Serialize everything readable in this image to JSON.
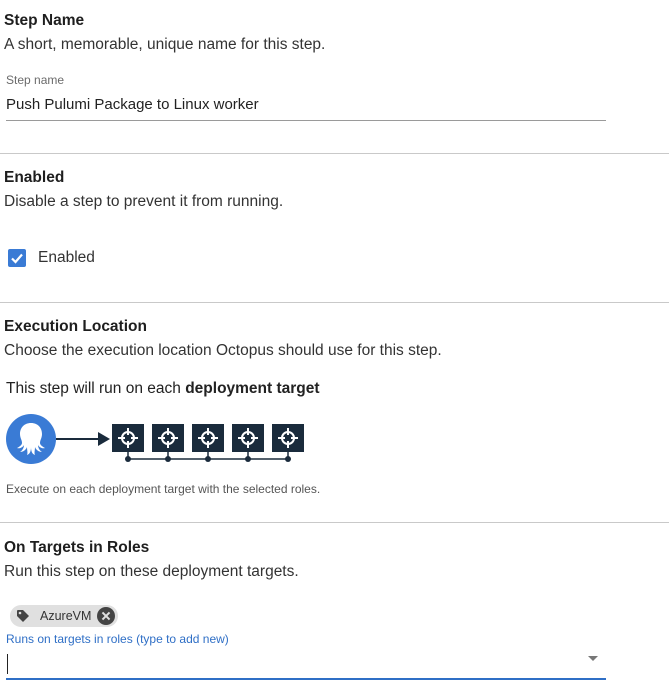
{
  "step_name_section": {
    "title": "Step Name",
    "description": "A short, memorable, unique name for this step.",
    "field_label": "Step name",
    "field_value": "Push Pulumi Package to Linux worker"
  },
  "enabled_section": {
    "title": "Enabled",
    "description": "Disable a step to prevent it from running.",
    "checkbox_label": "Enabled",
    "checked": true
  },
  "execution_section": {
    "title": "Execution Location",
    "description": "Choose the execution location Octopus should use for this step.",
    "run_text_prefix": "This step will run on each ",
    "run_text_bold": "deployment target",
    "hint": "Execute on each deployment target with the selected roles.",
    "diagram": {
      "source_icon": "octopus-icon",
      "target_icon": "deployment-target-icon",
      "target_count": 5,
      "colors": {
        "octopus_bg": "#3a7bd5",
        "target_bg": "#1a2b3c",
        "line": "#1a2b3c"
      }
    }
  },
  "roles_section": {
    "title": "On Targets in Roles",
    "description": "Run this step on these deployment targets.",
    "chips": [
      {
        "label": "AzureVM",
        "icon": "tag-icon"
      }
    ],
    "input_label": "Runs on targets in roles (type to add new)",
    "input_value": "",
    "accent_color": "#2f6fc6"
  }
}
